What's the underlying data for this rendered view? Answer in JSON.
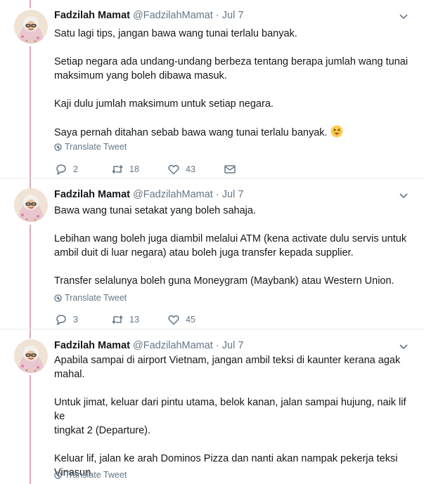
{
  "colors": {
    "thread_line": "#e8a3b9",
    "secondary_text": "#657786",
    "primary_text": "#14171a"
  },
  "tweets": [
    {
      "name": "Fadzilah Mamat",
      "handle": "@FadzilahMamat",
      "dot": "·",
      "time": "Jul 7",
      "lines": [
        "Satu lagi tips, jangan bawa wang tunai terlalu banyak.",
        "",
        "Setiap negara ada undang-undang berbeza tentang berapa jumlah wang tunai",
        "maksimum yang boleh dibawa masuk.",
        "",
        "Kaji dulu jumlah maksimum untuk setiap negara.",
        "",
        "Saya pernah ditahan sebab bawa wang tunai terlalu banyak."
      ],
      "emoji": "squinting-face-with-tongue",
      "translate": "Translate Tweet",
      "replies": "2",
      "retweets": "18",
      "likes": "43"
    },
    {
      "name": "Fadzilah Mamat",
      "handle": "@FadzilahMamat",
      "dot": "·",
      "time": "Jul 7",
      "lines": [
        "Bawa wang tunai setakat yang boleh sahaja.",
        "",
        "Lebihan wang boleh juga diambil melalui ATM (kena activate dulu servis untuk",
        "ambil duit di luar negara) atau boleh juga transfer kepada supplier.",
        "",
        "Transfer selalunya boleh guna Moneygram (Maybank) atau Western Union."
      ],
      "translate": "Translate Tweet",
      "replies": "3",
      "retweets": "13",
      "likes": "45"
    },
    {
      "name": "Fadzilah Mamat",
      "handle": "@FadzilahMamat",
      "dot": "·",
      "time": "Jul 7",
      "lines": [
        "Apabila sampai di airport Vietnam, jangan ambil teksi di kaunter kerana agak",
        "mahal.",
        "",
        "Untuk jimat, keluar dari pintu utama, belok kanan, jalan sampai hujung, naik lif ke",
        "tingkat 2 (Departure).",
        "",
        "Keluar lif, jalan ke arah Dominos Pizza dan nanti akan nampak pekerja teksi",
        "Vinasun."
      ],
      "translate": "Translate Tweet"
    }
  ]
}
